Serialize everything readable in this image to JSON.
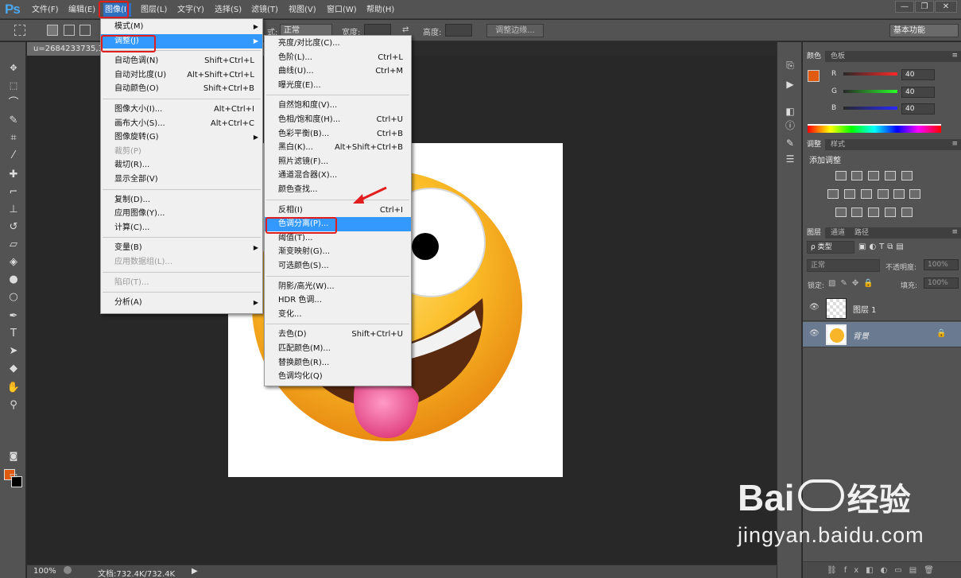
{
  "app": {
    "logo": "Ps"
  },
  "menubar": {
    "items": [
      "文件(F)",
      "编辑(E)",
      "图像(I)",
      "图层(L)",
      "文字(Y)",
      "选择(S)",
      "滤镜(T)",
      "视图(V)",
      "窗口(W)",
      "帮助(H)"
    ],
    "active_index": 2
  },
  "window_controls": {
    "minimize": "—",
    "restore": "❐",
    "close": "✕"
  },
  "options": {
    "style_label": "式:",
    "style_value": "正常",
    "width_label": "宽度:",
    "height_label": "高度:",
    "refine_edge": "调整边缘...",
    "workspace": "基本功能"
  },
  "document": {
    "tab_title": "u=2684233735,38",
    "zoom": "100%",
    "doc_info": "文档:732.4K/732.4K"
  },
  "image_menu": {
    "items": [
      {
        "label": "模式(M)",
        "shortcut": "",
        "submenu": true,
        "disabled": false
      },
      {
        "label": "调整(J)",
        "shortcut": "",
        "submenu": true,
        "disabled": false,
        "highlight": true
      },
      {
        "sep": true
      },
      {
        "label": "自动色调(N)",
        "shortcut": "Shift+Ctrl+L"
      },
      {
        "label": "自动对比度(U)",
        "shortcut": "Alt+Shift+Ctrl+L"
      },
      {
        "label": "自动颜色(O)",
        "shortcut": "Shift+Ctrl+B"
      },
      {
        "sep": true
      },
      {
        "label": "图像大小(I)...",
        "shortcut": "Alt+Ctrl+I"
      },
      {
        "label": "画布大小(S)...",
        "shortcut": "Alt+Ctrl+C"
      },
      {
        "label": "图像旋转(G)",
        "shortcut": "",
        "submenu": true
      },
      {
        "label": "裁剪(P)",
        "shortcut": "",
        "disabled": true
      },
      {
        "label": "裁切(R)...",
        "shortcut": ""
      },
      {
        "label": "显示全部(V)",
        "shortcut": ""
      },
      {
        "sep": true
      },
      {
        "label": "复制(D)...",
        "shortcut": ""
      },
      {
        "label": "应用图像(Y)...",
        "shortcut": ""
      },
      {
        "label": "计算(C)...",
        "shortcut": ""
      },
      {
        "sep": true
      },
      {
        "label": "变量(B)",
        "shortcut": "",
        "submenu": true
      },
      {
        "label": "应用数据组(L)...",
        "shortcut": "",
        "disabled": true
      },
      {
        "sep": true
      },
      {
        "label": "陷印(T)...",
        "shortcut": "",
        "disabled": true
      },
      {
        "sep": true
      },
      {
        "label": "分析(A)",
        "shortcut": "",
        "submenu": true
      }
    ]
  },
  "adjust_menu": {
    "items": [
      {
        "label": "亮度/对比度(C)...",
        "shortcut": ""
      },
      {
        "label": "色阶(L)...",
        "shortcut": "Ctrl+L"
      },
      {
        "label": "曲线(U)...",
        "shortcut": "Ctrl+M"
      },
      {
        "label": "曝光度(E)...",
        "shortcut": ""
      },
      {
        "sep": true
      },
      {
        "label": "自然饱和度(V)...",
        "shortcut": ""
      },
      {
        "label": "色相/饱和度(H)...",
        "shortcut": "Ctrl+U"
      },
      {
        "label": "色彩平衡(B)...",
        "shortcut": "Ctrl+B"
      },
      {
        "label": "黑白(K)...",
        "shortcut": "Alt+Shift+Ctrl+B"
      },
      {
        "label": "照片滤镜(F)...",
        "shortcut": ""
      },
      {
        "label": "通道混合器(X)...",
        "shortcut": ""
      },
      {
        "label": "颜色查找...",
        "shortcut": ""
      },
      {
        "sep": true
      },
      {
        "label": "反相(I)",
        "shortcut": "Ctrl+I"
      },
      {
        "label": "色调分离(P)...",
        "shortcut": "",
        "highlight": true
      },
      {
        "label": "阈值(T)...",
        "shortcut": ""
      },
      {
        "label": "渐变映射(G)...",
        "shortcut": ""
      },
      {
        "label": "可选颜色(S)...",
        "shortcut": ""
      },
      {
        "sep": true
      },
      {
        "label": "阴影/高光(W)...",
        "shortcut": ""
      },
      {
        "label": "HDR 色调...",
        "shortcut": ""
      },
      {
        "label": "变化...",
        "shortcut": ""
      },
      {
        "sep": true
      },
      {
        "label": "去色(D)",
        "shortcut": "Shift+Ctrl+U"
      },
      {
        "label": "匹配颜色(M)...",
        "shortcut": ""
      },
      {
        "label": "替换颜色(R)...",
        "shortcut": ""
      },
      {
        "label": "色调均化(Q)",
        "shortcut": ""
      }
    ]
  },
  "color_panel": {
    "tabs": [
      "颜色",
      "色板"
    ],
    "channels": [
      {
        "name": "R",
        "value": "40"
      },
      {
        "name": "G",
        "value": "40"
      },
      {
        "name": "B",
        "value": "40"
      }
    ],
    "foreground": "#e05a10",
    "background": "#000000"
  },
  "adjust_panel": {
    "tabs": [
      "调整",
      "样式"
    ],
    "title": "添加调整"
  },
  "layers_panel": {
    "tabs": [
      "图层",
      "通道",
      "路径"
    ],
    "filter": "ρ 类型",
    "blend_mode": "正常",
    "opacity_label": "不透明度:",
    "opacity_value": "100%",
    "lock_label": "锁定:",
    "fill_label": "填充:",
    "fill_value": "100%",
    "layers": [
      {
        "name": "图层 1",
        "selected": false
      },
      {
        "name": "背景",
        "selected": true
      }
    ]
  },
  "watermark": {
    "brand": "Bai",
    "brand_cn": "经验",
    "url": "jingyan.baidu.com"
  },
  "colors": {
    "menu_highlight": "#3399ff",
    "annotation_red": "#e21d1d",
    "ps_blue": "#4aa8f0"
  }
}
